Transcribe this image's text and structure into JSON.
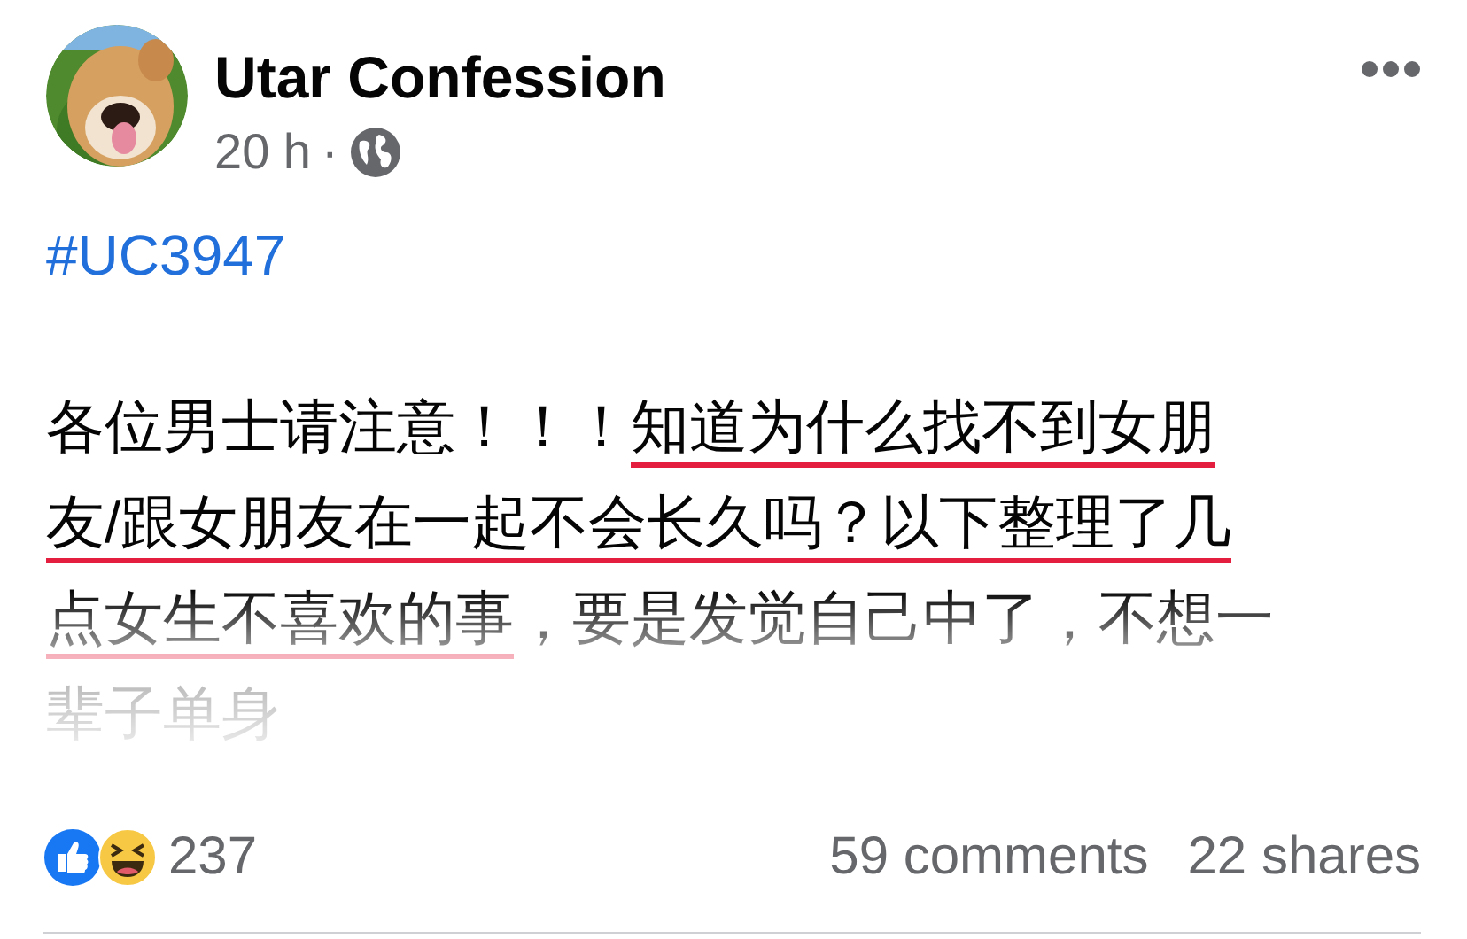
{
  "post": {
    "author": "Utar Confession",
    "time": "20 h",
    "separator": "·",
    "hashtag": "#UC3947",
    "lines": [
      [
        {
          "text": "各位男士请注意！！！",
          "underlined": false
        },
        {
          "text": "知道为什么找不到女朋",
          "underlined": true
        }
      ],
      [
        {
          "text": "友/跟女朋友在一起不会长久吗？以下整理了几",
          "underlined": true
        }
      ],
      [
        {
          "text": "点女生不喜欢的事",
          "underlined": true
        },
        {
          "text": "，要是发觉自己中了，不想一",
          "underlined": false
        }
      ],
      [
        {
          "text": "辈子单身",
          "underlined": false
        }
      ]
    ],
    "reactions_count": "237",
    "comments": "59 comments",
    "shares": "22 shares"
  }
}
